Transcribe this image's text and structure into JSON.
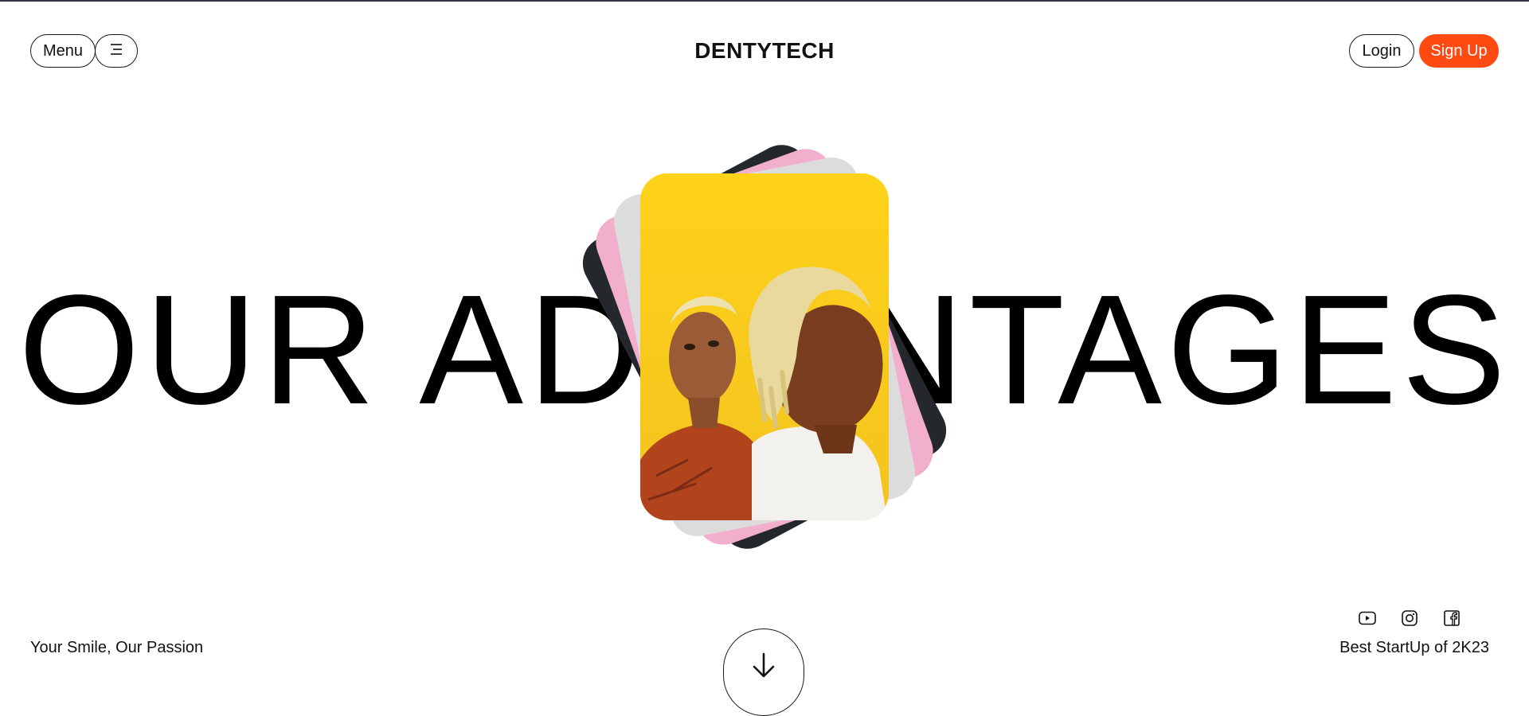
{
  "header": {
    "menu_label": "Menu",
    "menu_icon": "hamburger-icon",
    "logo": "DENTYTECH",
    "login_label": "Login",
    "signup_label": "Sign Up"
  },
  "hero": {
    "title": "OUR ADVANTAGES",
    "cards": [
      "dark",
      "pink",
      "grey",
      "photo"
    ]
  },
  "footer": {
    "tagline": "Your Smile, Our Passion",
    "award": "Best StartUp of 2K23",
    "scroll_icon": "arrow-down-icon",
    "social_icons": [
      "youtube-icon",
      "instagram-icon",
      "facebook-icon"
    ]
  },
  "colors": {
    "accent": "#ff4a12",
    "photo_bg": "#ffd21a",
    "card_dark": "#24272b",
    "card_pink": "#f2afcb",
    "card_grey": "#dcdcdc"
  }
}
